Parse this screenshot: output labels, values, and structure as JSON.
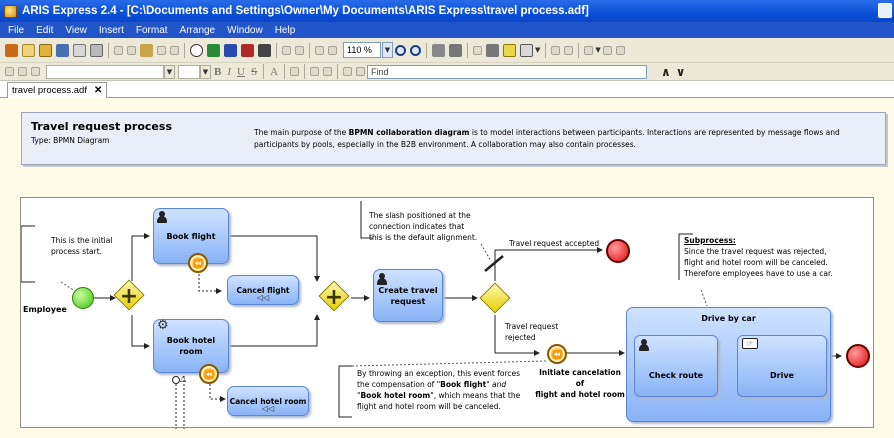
{
  "window": {
    "title": "ARIS Express 2.4 - [C:\\Documents and Settings\\Owner\\My Documents\\ARIS Express\\travel process.adf]"
  },
  "menu": [
    "File",
    "Edit",
    "View",
    "Insert",
    "Format",
    "Arrange",
    "Window",
    "Help"
  ],
  "toolbar": {
    "zoom": "110 %",
    "find_placeholder": "Find"
  },
  "tabs": [
    {
      "label": "travel process.adf"
    }
  ],
  "info": {
    "title": "Travel request process",
    "type": "Type: BPMN Diagram",
    "description_pre": "The main purpose of the ",
    "description_bold": "BPMN collaboration diagram",
    "description_post": " is to model interactions between participants. Interactions are represented by message flows and participants by pools, especially in the B2B environment. A collaboration may also contain processes."
  },
  "diagram": {
    "pool_label": "Employee",
    "notes": {
      "start": [
        "This is the initial",
        "process start."
      ],
      "slash": [
        "The slash positioned at the",
        "connection indicates that",
        "this is the default alignment."
      ],
      "subprocess_title": "Subprocess:",
      "subprocess": [
        "Since the travel request was rejected,",
        "flight and hotel room will be canceled.",
        "Therefore employees have to use a car."
      ],
      "exception_1": "By throwing an exception, this event forces",
      "exception_2a": "the compensation of \"",
      "exception_2b": "Book flight",
      "exception_2c": "\" and",
      "exception_3a": "\"",
      "exception_3b": "Book hotel room",
      "exception_3c": "\", which means that the",
      "exception_4": "flight and hotel room will be canceled."
    },
    "tasks": {
      "book_flight": "Book flight",
      "cancel_flight": "Cancel flight",
      "book_hotel": "Book hotel room",
      "cancel_hotel": "Cancel hotel room",
      "create_travel_request": [
        "Create travel",
        "request"
      ],
      "drive_by_car": "Drive by car",
      "check_route": "Check route",
      "drive": "Drive"
    },
    "flows": {
      "accepted": "Travel request accepted",
      "rejected": [
        "Travel request",
        "rejected"
      ],
      "initiate_cancel": [
        "Initiate cancelation of",
        "flight and hotel room"
      ]
    },
    "colors": {
      "task_fill": "#89b3f6",
      "gateway": "#e6d000",
      "start_event": "#3bc30d",
      "end_event": "#e00d0d",
      "intermediate_event": "#f0a000"
    }
  }
}
